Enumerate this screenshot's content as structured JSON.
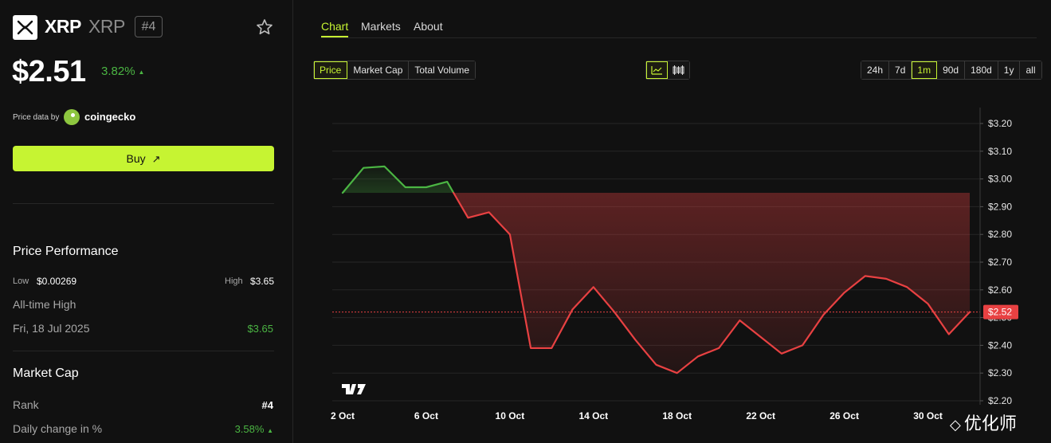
{
  "coin": {
    "name": "XRP",
    "symbol": "XRP",
    "rank_badge": "#4",
    "price": "$2.51",
    "change_24h": "3.82%",
    "change_dir": "▲",
    "price_data_label": "Price data by",
    "provider": "coingecko"
  },
  "buy_label": "Buy",
  "performance": {
    "title": "Price Performance",
    "low_label": "Low",
    "low_value": "$0.00269",
    "high_label": "High",
    "high_value": "$3.65",
    "ath_label": "All-time High",
    "ath_date": "Fri, 18 Jul 2025",
    "ath_value": "$3.65"
  },
  "market_cap": {
    "title": "Market Cap",
    "rank_label": "Rank",
    "rank_value": "#4",
    "daily_change_label": "Daily change in %",
    "daily_change_value": "3.58%",
    "daily_change_dir": "▲"
  },
  "tabs": [
    "Chart",
    "Markets",
    "About"
  ],
  "metric_buttons": [
    "Price",
    "Market Cap",
    "Total Volume"
  ],
  "range_buttons": [
    "24h",
    "7d",
    "1m",
    "90d",
    "180d",
    "1y",
    "all"
  ],
  "active_range": "1m",
  "watermark_text": "优化师",
  "colors": {
    "accent": "#c6f432",
    "up": "#4bb543",
    "down": "#e84142",
    "background": "#111111"
  },
  "icons": [
    "xrp-logo-icon",
    "star-icon",
    "coingecko-icon",
    "arrow-up-right-icon",
    "line-chart-icon",
    "candlestick-icon",
    "tradingview-icon"
  ],
  "chart_data": {
    "type": "line",
    "x": [
      "2 Oct",
      "3 Oct",
      "4 Oct",
      "5 Oct",
      "6 Oct",
      "7 Oct",
      "8 Oct",
      "9 Oct",
      "10 Oct",
      "11 Oct",
      "12 Oct",
      "13 Oct",
      "14 Oct",
      "15 Oct",
      "16 Oct",
      "17 Oct",
      "18 Oct",
      "19 Oct",
      "20 Oct",
      "21 Oct",
      "22 Oct",
      "23 Oct",
      "24 Oct",
      "25 Oct",
      "26 Oct",
      "27 Oct",
      "28 Oct",
      "29 Oct",
      "30 Oct",
      "31 Oct",
      "1 Nov"
    ],
    "values": [
      2.95,
      3.04,
      3.045,
      2.97,
      2.97,
      2.99,
      2.86,
      2.88,
      2.8,
      2.39,
      2.39,
      2.53,
      2.61,
      2.52,
      2.42,
      2.33,
      2.3,
      2.36,
      2.39,
      2.49,
      2.43,
      2.37,
      2.4,
      2.51,
      2.59,
      2.65,
      2.64,
      2.61,
      2.55,
      2.44,
      2.52
    ],
    "baseline": 2.95,
    "current_value": 2.52,
    "current_label": "$2.52",
    "y_ticks": [
      "$3.20",
      "$3.10",
      "$3.00",
      "$2.90",
      "$2.80",
      "$2.70",
      "$2.60",
      "$2.50",
      "$2.40",
      "$2.30",
      "$2.20"
    ],
    "y_tick_values": [
      3.2,
      3.1,
      3.0,
      2.9,
      2.8,
      2.7,
      2.6,
      2.5,
      2.4,
      2.3,
      2.2
    ],
    "x_tick_labels": [
      "2 Oct",
      "6 Oct",
      "10 Oct",
      "14 Oct",
      "18 Oct",
      "22 Oct",
      "26 Oct",
      "30 Oct"
    ],
    "ylim": [
      2.2,
      3.2
    ],
    "grid": true,
    "above_color": "#4bb543",
    "below_color": "#e84142"
  }
}
